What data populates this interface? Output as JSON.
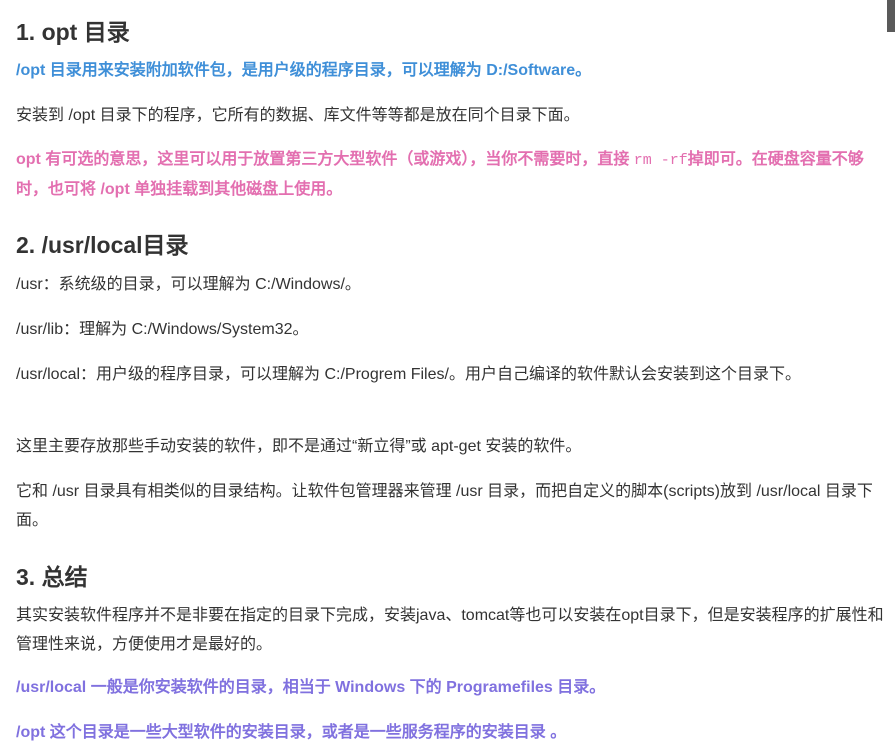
{
  "section1": {
    "heading": "1. opt 目录",
    "blue_line": "/opt 目录用来安装附加软件包，是用户级的程序目录，可以理解为 D:/Software。",
    "p1": "安装到 /opt 目录下的程序，它所有的数据、库文件等等都是放在同个目录下面。",
    "pink_a": "opt 有可选的意思，这里可以用于放置第三方大型软件（或游戏），当你不需要时，直接 ",
    "pink_code": "rm -rf",
    "pink_b": "掉即可。在硬盘容量不够时，也可将 /opt 单独挂载到其他磁盘上使用。"
  },
  "section2": {
    "heading": "2. /usr/local目录",
    "p1": "/usr：系统级的目录，可以理解为 C:/Windows/。",
    "p2": "/usr/lib：理解为 C:/Windows/System32。",
    "p3": "/usr/local：用户级的程序目录，可以理解为 C:/Progrem Files/。用户自己编译的软件默认会安装到这个目录下。",
    "p4": "这里主要存放那些手动安装的软件，即不是通过“新立得”或 apt-get 安装的软件。",
    "p5": "它和 /usr 目录具有相类似的目录结构。让软件包管理器来管理 /usr 目录，而把自定义的脚本(scripts)放到 /usr/local 目录下面。"
  },
  "section3": {
    "heading": "3. 总结",
    "p1": "其实安装软件程序并不是非要在指定的目录下完成，安装java、tomcat等也可以安装在opt目录下，但是安装程序的扩展性和管理性来说，方便使用才是最好的。",
    "purple1": "/usr/local 一般是你安装软件的目录，相当于 Windows 下的 Programefiles 目录。",
    "purple2": "/opt 这个目录是一些大型软件的安装目录，或者是一些服务程序的安装目录 。"
  },
  "colors": {
    "blue": "#3f8fd8",
    "pink": "#e36fb0",
    "purple": "#8071df",
    "text": "#333333"
  }
}
